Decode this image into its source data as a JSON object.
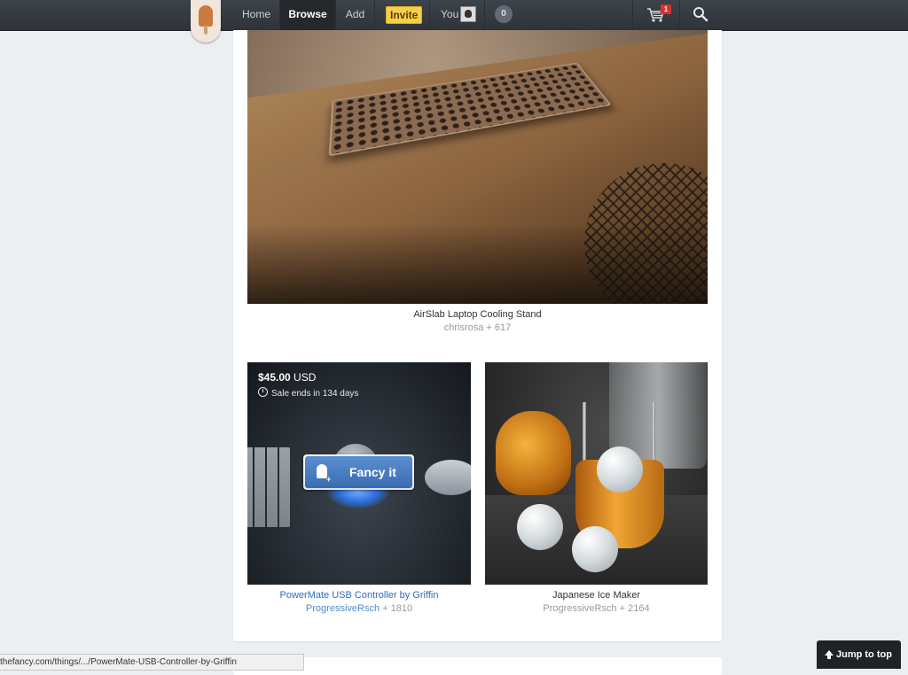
{
  "nav": {
    "home": "Home",
    "browse": "Browse",
    "add": "Add",
    "invite": "Invite",
    "you": "You",
    "notification_count": "0",
    "cart_count": "1",
    "icons": [
      "logo-popsicle-icon",
      "avatar",
      "cart-icon",
      "search-icon"
    ]
  },
  "items": [
    {
      "title": "AirSlab Laptop Cooling Stand",
      "user": "chrisrosa",
      "count": "+ 617"
    },
    {
      "title": "PowerMate USB Controller by Griffin",
      "user": "ProgressiveRsch",
      "count": "+ 1810",
      "price_amount": "$45.00",
      "price_currency": "USD",
      "sale_text": "Sale ends in 134 days",
      "fancy_label": "Fancy it"
    },
    {
      "title": "Japanese Ice Maker",
      "user": "ProgressiveRsch",
      "count": "+ 2164"
    }
  ],
  "status_url": "thefancy.com/things/.../PowerMate-USB-Controller-by-Griffin",
  "jump_label": "Jump to top",
  "colors": {
    "nav_bg": "#353a41",
    "invite_bg": "#f6cf4a",
    "fancy_button": "#3a6cb1",
    "link": "#2b6fb6",
    "cart_badge": "#d9312b"
  }
}
